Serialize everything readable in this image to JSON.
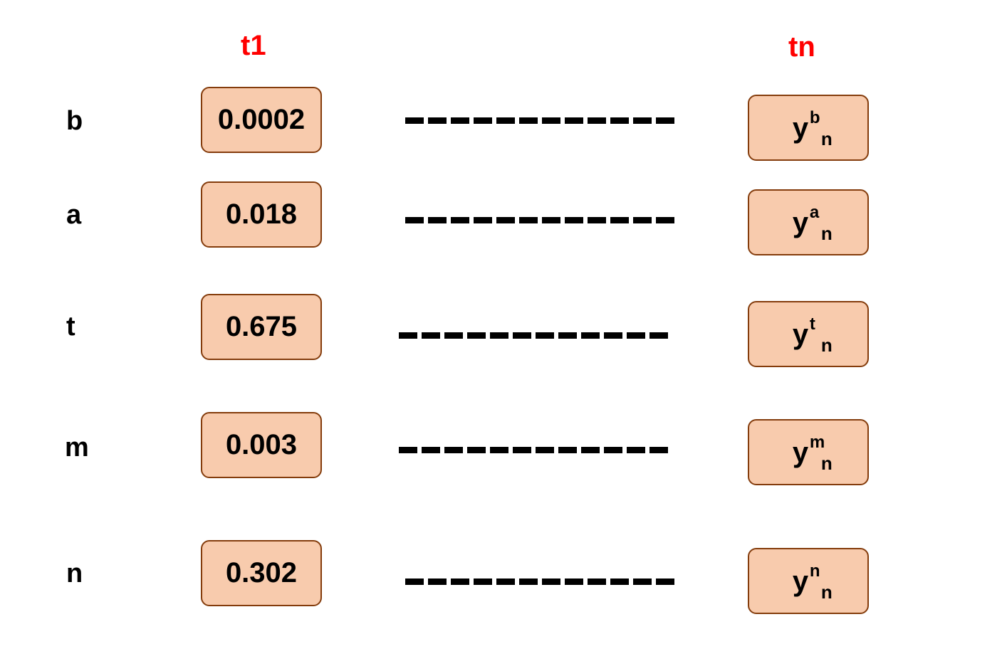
{
  "headers": {
    "first": "t1",
    "last": "tn"
  },
  "rows": [
    {
      "label": "b",
      "value": "0.0002",
      "y_base": "y",
      "y_sup": "b",
      "y_sub": "n"
    },
    {
      "label": "a",
      "value": "0.018",
      "y_base": "y",
      "y_sup": "a",
      "y_sub": "n"
    },
    {
      "label": "t",
      "value": "0.675",
      "y_base": "y",
      "y_sup": "t",
      "y_sub": "n"
    },
    {
      "label": "m",
      "value": "0.003",
      "y_base": "y",
      "y_sup": "m",
      "y_sub": "n"
    },
    {
      "label": "n",
      "value": "0.302",
      "y_base": "y",
      "y_sup": "n",
      "y_sub": "n"
    }
  ],
  "colors": {
    "header": "#ff0000",
    "box_fill": "#f8cbad",
    "box_border": "#843c0c"
  }
}
